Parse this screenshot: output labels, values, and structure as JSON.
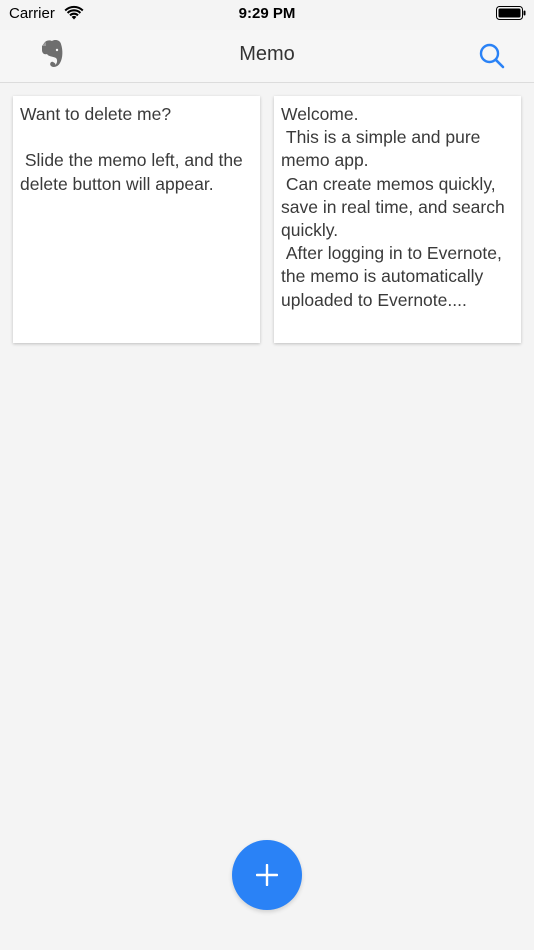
{
  "status_bar": {
    "carrier": "Carrier",
    "time": "9:29 PM",
    "wifi_icon": "wifi-icon",
    "battery_icon": "battery-icon"
  },
  "nav": {
    "title": "Memo",
    "left_icon": "evernote-icon",
    "right_icon": "search-icon"
  },
  "memos": [
    {
      "text": "Want to delete me?\n\n Slide the memo left, and the delete button will appear."
    },
    {
      "text": "Welcome.\n This is a simple and pure memo app.\n Can create memos quickly, save in real time, and search quickly.\n After logging in to Evernote, the memo is automatically uploaded to Evernote...."
    }
  ],
  "fab": {
    "icon": "plus-icon"
  },
  "colors": {
    "accent": "#2a82f6",
    "background": "#f4f4f4",
    "card": "#ffffff",
    "icon_gray": "#6e6e6e"
  }
}
